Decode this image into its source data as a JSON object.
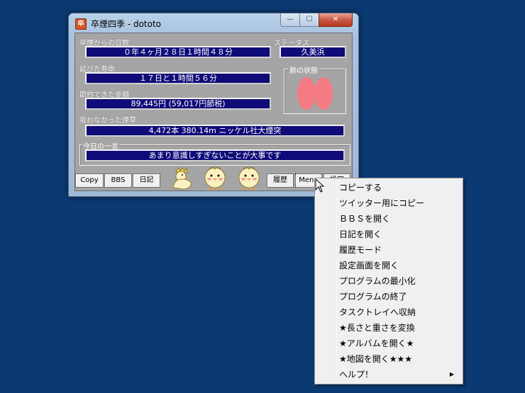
{
  "window": {
    "title": "卒煙四季 - dototo",
    "icon_text": "卒",
    "controls": {
      "minimize": "—",
      "maximize": "☐",
      "close": "✕"
    }
  },
  "days": {
    "label": "卒煙からの日数",
    "value": "０年４ヶ月２８日１時間４８分"
  },
  "status": {
    "label": "ステータス",
    "value": "久美浜"
  },
  "life": {
    "label": "延びた寿命",
    "value": "１７日と１時間５６分"
  },
  "lungs": {
    "label": "肺の状態",
    "color": "#f47a84"
  },
  "money": {
    "label": "節約できた金額",
    "value": "89,445円 (59,017円節税)"
  },
  "cigs": {
    "label": "吸わなかった煙草",
    "value": "4,472本 380.14m ニッケル社大煙突"
  },
  "phrase": {
    "label": "今日の一言",
    "value": "あまり意識しすぎないことが大事です"
  },
  "buttons": {
    "copy": "Copy",
    "bbs": "BBS",
    "diary": "日記",
    "history": "履歴",
    "menu": "Menu",
    "settings": "設定"
  },
  "menu": {
    "items": [
      "コピーする",
      "ツイッター用にコピー",
      "ＢＢＳを開く",
      "日記を開く",
      "履歴モード",
      "設定画面を開く",
      "プログラムの最小化",
      "プログラムの終了",
      "タスクトレイへ収納",
      "★長さと重さを変換",
      "★アルバムを開く★",
      "★地図を開く★★★",
      "ヘルプ！"
    ],
    "submenu_arrow": "▶"
  }
}
